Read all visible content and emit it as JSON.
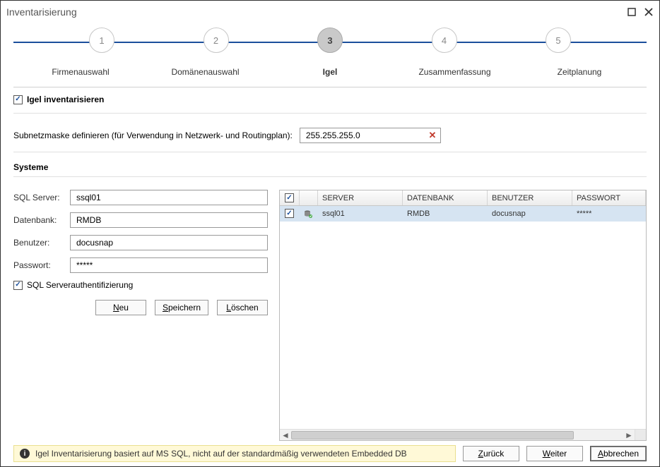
{
  "window": {
    "title": "Inventarisierung"
  },
  "wizard": {
    "steps": [
      {
        "num": "1",
        "label": "Firmenauswahl"
      },
      {
        "num": "2",
        "label": "Domänenauswahl"
      },
      {
        "num": "3",
        "label": "Igel"
      },
      {
        "num": "4",
        "label": "Zusammenfassung"
      },
      {
        "num": "5",
        "label": "Zeitplanung"
      }
    ],
    "active_index": 2
  },
  "igel_checkbox_label": "Igel inventarisieren",
  "subnet": {
    "label": "Subnetzmaske definieren (für Verwendung in Netzwerk- und Routingplan):",
    "value": "255.255.255.0"
  },
  "systems_title": "Systeme",
  "form": {
    "sql_server": {
      "label": "SQL Server:",
      "value": "ssql01"
    },
    "database": {
      "label": "Datenbank:",
      "value": "RMDB"
    },
    "user": {
      "label": "Benutzer:",
      "value": "docusnap"
    },
    "password": {
      "label": "Passwort:",
      "value": "*****"
    },
    "sql_auth_label": "SQL Serverauthentifizierung",
    "buttons": {
      "new": "Neu",
      "save": "Speichern",
      "delete": "Löschen"
    }
  },
  "table": {
    "headers": {
      "server": "SERVER",
      "database": "DATENBANK",
      "user": "BENUTZER",
      "password": "PASSWORT"
    },
    "rows": [
      {
        "checked": true,
        "server": "ssql01",
        "database": "RMDB",
        "user": "docusnap",
        "password": "*****"
      }
    ]
  },
  "info_message": "Igel Inventarisierung basiert auf MS SQL, nicht auf der standardmäßig verwendeten Embedded DB",
  "nav": {
    "back": "Zurück",
    "next": "Weiter",
    "cancel": "Abbrechen"
  }
}
